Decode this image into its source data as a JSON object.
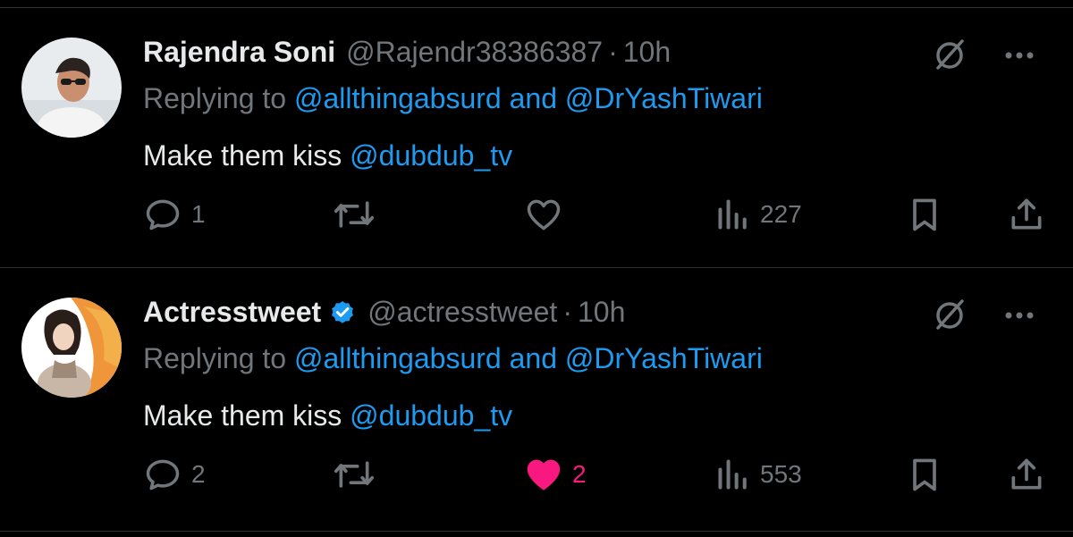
{
  "tweets": [
    {
      "name": "Rajendra Soni",
      "handle": "@Rajendr38386387",
      "dot": "·",
      "time": "10h",
      "verified": false,
      "replying_prefix": "Replying to",
      "replying_mentions": "@allthingabsurd and @DrYashTiwari",
      "text_plain": "Make them kiss",
      "text_mention": "@dubdub_tv",
      "replies": "1",
      "retweets": "",
      "likes": "",
      "liked": false,
      "views": "227"
    },
    {
      "name": "Actresstweet",
      "handle": "@actresstweet",
      "dot": "·",
      "time": "10h",
      "verified": true,
      "replying_prefix": "Replying to",
      "replying_mentions": "@allthingabsurd and @DrYashTiwari",
      "text_plain": "Make them kiss",
      "text_mention": "@dubdub_tv",
      "replies": "2",
      "retweets": "",
      "likes": "2",
      "liked": true,
      "views": "553"
    }
  ],
  "icons": {
    "grok": "slashed-circle-icon",
    "more": "more-dots-icon",
    "reply": "reply-icon",
    "retweet": "retweet-icon",
    "like": "heart-icon",
    "views": "views-icon",
    "bookmark": "bookmark-icon",
    "share": "share-icon"
  },
  "colors": {
    "background": "#000000",
    "text": "#e7e9ea",
    "muted": "#71767b",
    "link": "#1d9bf0",
    "like": "#f91880",
    "divider": "#2f3336"
  }
}
